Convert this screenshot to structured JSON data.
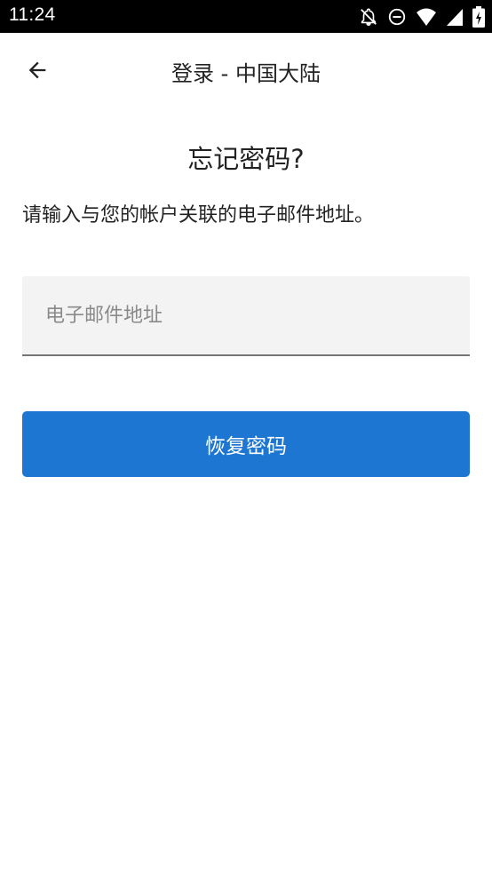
{
  "status_bar": {
    "time": "11:24",
    "icons": [
      "notifications-off-icon",
      "do-not-disturb-icon",
      "wifi-icon",
      "signal-icon",
      "battery-charging-icon"
    ]
  },
  "app_bar": {
    "back_icon": "arrow-left-icon",
    "title": "登录 - 中国大陆"
  },
  "main": {
    "heading": "忘记密码?",
    "instructions": "请输入与您的帐户关联的电子邮件地址。",
    "email_field": {
      "value": "",
      "placeholder": "电子邮件地址"
    },
    "recover_button_label": "恢复密码"
  },
  "colors": {
    "status_bar_bg": "#000000",
    "primary_button": "#1d76d2",
    "input_bg": "#f3f3f3",
    "input_underline": "#757575",
    "text": "#222222",
    "placeholder": "#8a8a8a"
  }
}
